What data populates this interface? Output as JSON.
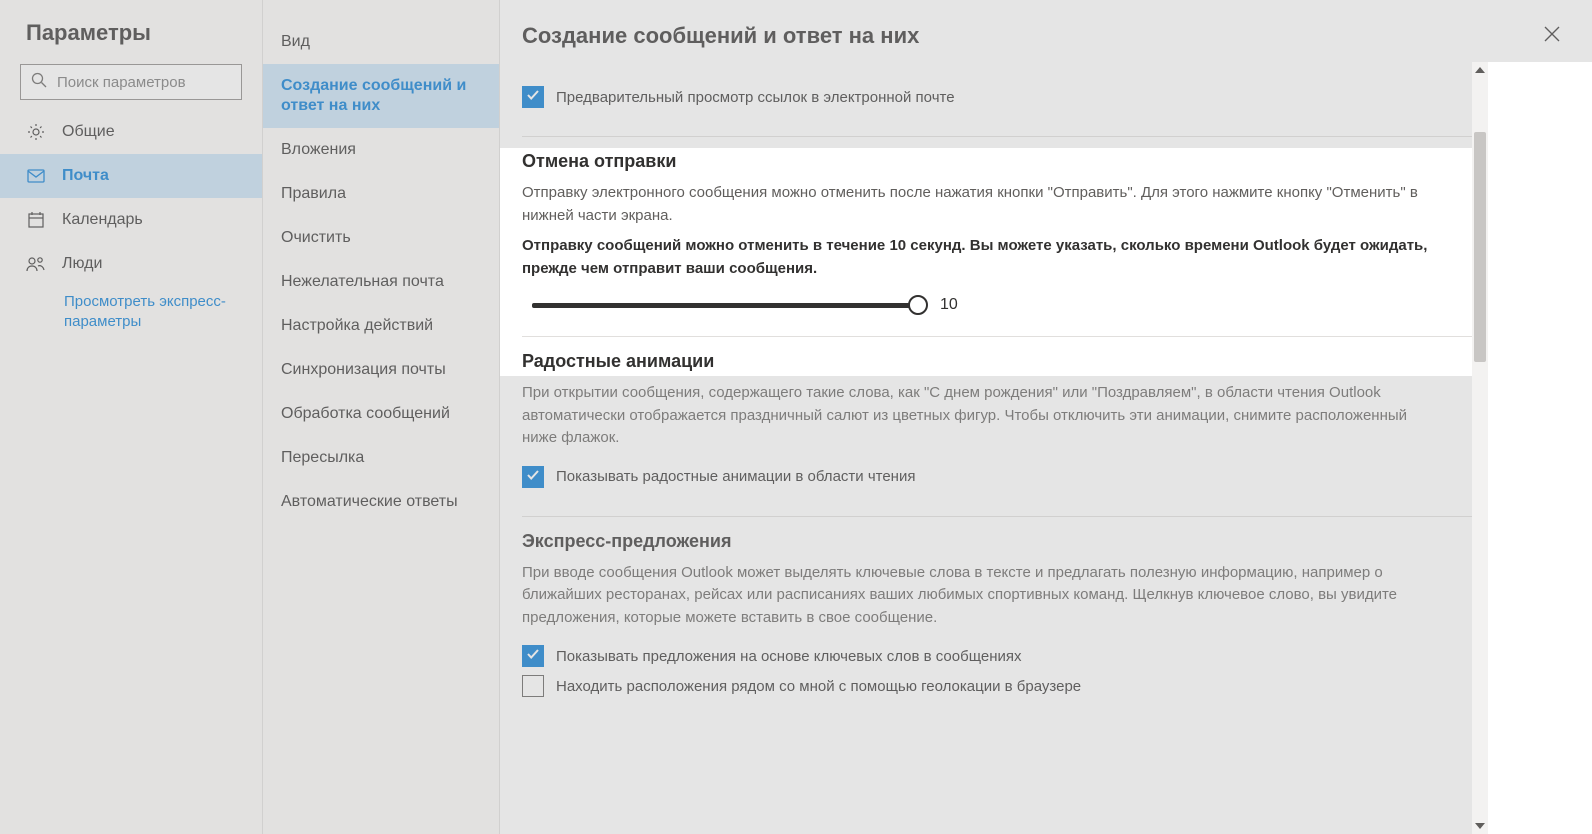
{
  "leftPanel": {
    "title": "Параметры",
    "searchPlaceholder": "Поиск параметров",
    "nav": [
      {
        "label": "Общие"
      },
      {
        "label": "Почта"
      },
      {
        "label": "Календарь"
      },
      {
        "label": "Люди"
      }
    ],
    "quickLink": "Просмотреть экспресс-параметры"
  },
  "midPanel": {
    "items": [
      "Вид",
      "Создание сообщений и ответ на них",
      "Вложения",
      "Правила",
      "Очистить",
      "Нежелательная почта",
      "Настройка действий",
      "Синхронизация почты",
      "Обработка сообщений",
      "Пересылка",
      "Автоматические ответы"
    ]
  },
  "main": {
    "title": "Создание сообщений и ответ на них",
    "linkPreview": {
      "checkboxLabel": "Предварительный просмотр ссылок в электронной почте"
    },
    "undoSend": {
      "title": "Отмена отправки",
      "desc": "Отправку электронного сообщения можно отменить после нажатия кнопки \"Отправить\". Для этого нажмите кнопку \"Отменить\" в нижней части экрана.",
      "boldDesc": "Отправку сообщений можно отменить в течение 10 секунд. Вы можете указать, сколько времени Outlook будет ожидать, прежде чем отправит ваши сообщения.",
      "sliderValue": "10"
    },
    "joyful": {
      "title": "Радостные анимации",
      "desc": "При открытии сообщения, содержащего такие слова, как \"С днем рождения\" или \"Поздравляем\", в области чтения Outlook автоматически отображается праздничный салют из цветных фигур. Чтобы отключить эти анимации, снимите расположенный ниже флажок.",
      "checkboxLabel": "Показывать радостные анимации в области чтения"
    },
    "suggestions": {
      "title": "Экспресс-предложения",
      "desc": "При вводе сообщения Outlook может выделять ключевые слова в тексте и предлагать полезную информацию, например о ближайших ресторанах, рейсах или расписаниях ваших любимых спортивных команд. Щелкнув ключевое слово, вы увидите предложения, которые можете вставить в свое сообщение.",
      "checkbox1": "Показывать предложения на основе ключевых слов в сообщениях",
      "checkbox2": "Находить расположения рядом со мной с помощью геолокации в браузере"
    }
  }
}
